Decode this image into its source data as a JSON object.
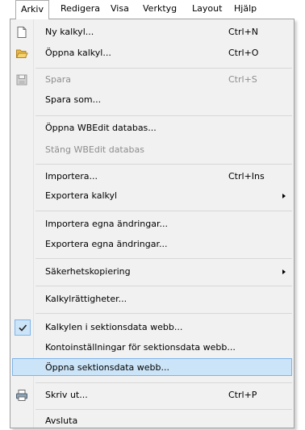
{
  "menubar": {
    "items": [
      {
        "label": "Arkiv"
      },
      {
        "label": "Redigera"
      },
      {
        "label": "Visa"
      },
      {
        "label": "Verktyg"
      },
      {
        "label": "Layout"
      },
      {
        "label": "Hjälp"
      }
    ],
    "active": "Arkiv"
  },
  "menu": {
    "items": [
      {
        "label": "Ny kalkyl...",
        "shortcut": "Ctrl+N",
        "icon": "new-document-icon",
        "enabled": true
      },
      {
        "label": "Öppna kalkyl...",
        "shortcut": "Ctrl+O",
        "icon": "open-folder-icon",
        "enabled": true
      },
      {
        "label": "Spara",
        "shortcut": "Ctrl+S",
        "icon": "save-disk-icon",
        "enabled": false
      },
      {
        "label": "Spara som...",
        "shortcut": "",
        "enabled": true
      },
      {
        "label": "Öppna WBEdit databas...",
        "shortcut": "",
        "enabled": true
      },
      {
        "label": "Stäng WBEdit databas",
        "shortcut": "",
        "enabled": false
      },
      {
        "label": "Importera...",
        "shortcut": "Ctrl+Ins",
        "enabled": true
      },
      {
        "label": "Exportera kalkyl",
        "shortcut": "",
        "submenu": true,
        "enabled": true
      },
      {
        "label": "Importera egna ändringar...",
        "shortcut": "",
        "enabled": true
      },
      {
        "label": "Exportera egna ändringar...",
        "shortcut": "",
        "enabled": true
      },
      {
        "label": "Säkerhetskopiering",
        "shortcut": "",
        "submenu": true,
        "enabled": true
      },
      {
        "label": "Kalkylrättigheter...",
        "shortcut": "",
        "enabled": true
      },
      {
        "label": "Kalkylen i sektionsdata webb...",
        "shortcut": "",
        "checked": true,
        "enabled": true
      },
      {
        "label": "Kontoinställningar för sektionsdata webb...",
        "shortcut": "",
        "enabled": true
      },
      {
        "label": "Öppna sektionsdata webb...",
        "shortcut": "",
        "highlighted": true,
        "enabled": true
      },
      {
        "label": "Skriv ut...",
        "shortcut": "Ctrl+P",
        "icon": "printer-icon",
        "enabled": true
      },
      {
        "label": "Avsluta",
        "shortcut": "",
        "enabled": true
      }
    ]
  },
  "colors": {
    "highlight_bg": "#cce4f7",
    "highlight_border": "#7eb4ea",
    "disabled_text": "#8d8d8d"
  }
}
